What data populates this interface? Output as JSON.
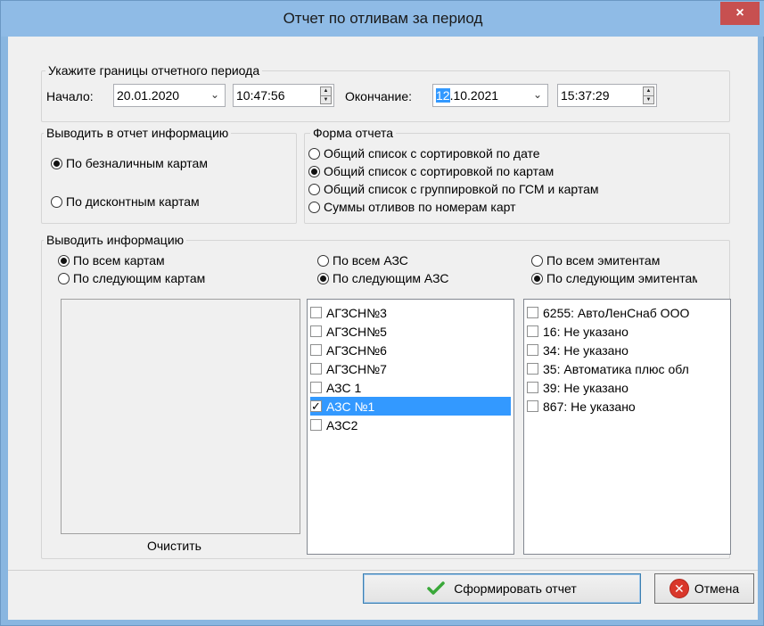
{
  "window": {
    "title": "Отчет по отливам за период",
    "close_glyph": "×"
  },
  "period": {
    "legend": "Укажите границы отчетного периода",
    "start_label": "Начало:",
    "start_date": "20.01.2020",
    "start_time": "10:47:56",
    "end_label": "Окончание:",
    "end_date_selected": "12",
    "end_date_rest": ".10.2021",
    "end_time": "15:37:29"
  },
  "info_output": {
    "legend": "Выводить в отчет информацию",
    "options": [
      "По безналичным картам",
      "По дисконтным картам"
    ],
    "selected": 0
  },
  "report_form": {
    "legend": "Форма отчета",
    "options": [
      "Общий список с сортировкой по дате",
      "Общий список с сортировкой по картам",
      "Общий список с группировкой по ГСМ и картам",
      "Суммы отливов по номерам карт"
    ],
    "selected": 1
  },
  "filters": {
    "legend": "Выводить информацию",
    "cards": {
      "all": "По всем картам",
      "following": "По следующим картам",
      "selected": "all",
      "clear_label": "Очистить"
    },
    "stations": {
      "all": "По всем АЗС",
      "following": "По следующим АЗС",
      "selected": "following",
      "items": [
        {
          "label": "АГЗСН№3",
          "checked": false
        },
        {
          "label": "АГЗСН№5",
          "checked": false
        },
        {
          "label": "АГЗСН№6",
          "checked": false
        },
        {
          "label": "АГЗСН№7",
          "checked": false
        },
        {
          "label": "АЗС 1",
          "checked": false
        },
        {
          "label": "АЗС №1",
          "checked": true,
          "selected": true
        },
        {
          "label": "АЗС2",
          "checked": false
        }
      ]
    },
    "issuers": {
      "all": "По всем эмитентам",
      "following": "По следующим эмитентам",
      "selected": "following",
      "items": [
        {
          "label": "6255: АвтоЛенСнаб ООО",
          "checked": false
        },
        {
          "label": "16: Не указано",
          "checked": false
        },
        {
          "label": "34: Не указано",
          "checked": false
        },
        {
          "label": "35: Автоматика плюс обл",
          "checked": false
        },
        {
          "label": "39: Не указано",
          "checked": false
        },
        {
          "label": "867: Не указано",
          "checked": false
        }
      ]
    }
  },
  "buttons": {
    "generate": "Сформировать отчет",
    "cancel": "Отмена"
  },
  "icons": {
    "check": "check-icon",
    "cancel": "cancel-icon",
    "dropdown": "chevron-down-icon"
  },
  "colors": {
    "titlebar": "#8fbbe6",
    "selection": "#3399ff",
    "check_green": "#3aa83a",
    "cancel_red": "#d9372b"
  }
}
